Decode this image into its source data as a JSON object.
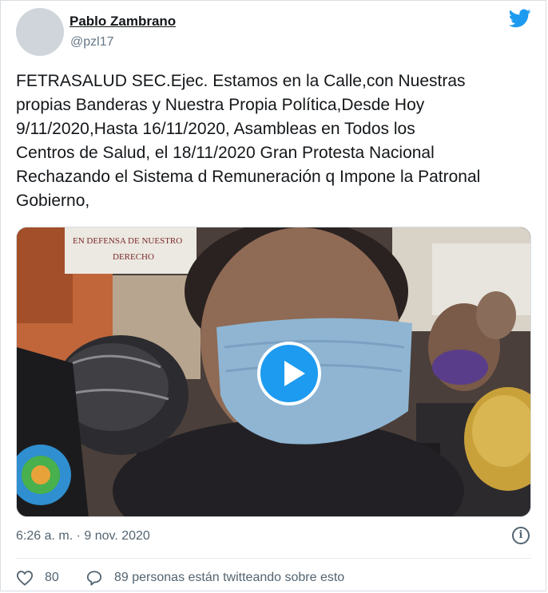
{
  "author": {
    "name": "Pablo Zambrano",
    "handle": "@pzl17"
  },
  "icons": {
    "brand": "twitter-bird-icon",
    "play": "play-icon",
    "info": "info-icon",
    "like": "heart-icon",
    "reply": "speech-bubble-icon"
  },
  "tweet": {
    "text": "FETRASALUD SEC.Ejec. Estamos en la Calle,con Nuestras\npropias Banderas y Nuestra Propia Política,Desde Hoy\n9/11/2020,Hasta 16/11/2020, Asambleas en Todos los\nCentros de Salud, el 18/11/2020 Gran Protesta Nacional\nRechazando el Sistema d Remuneración q Impone la Patronal\nGobierno,"
  },
  "media": {
    "sign_text": "EN DEFENSA DE NUESTRO\nDERECHO"
  },
  "meta": {
    "timestamp": "6:26 a. m. · 9 nov. 2020",
    "info_glyph": "i"
  },
  "actions": {
    "like_count": "80",
    "reply_text": "89 personas están twitteando sobre esto"
  },
  "colors": {
    "twitter_blue": "#1d9bf0",
    "secondary_text": "#536471"
  }
}
